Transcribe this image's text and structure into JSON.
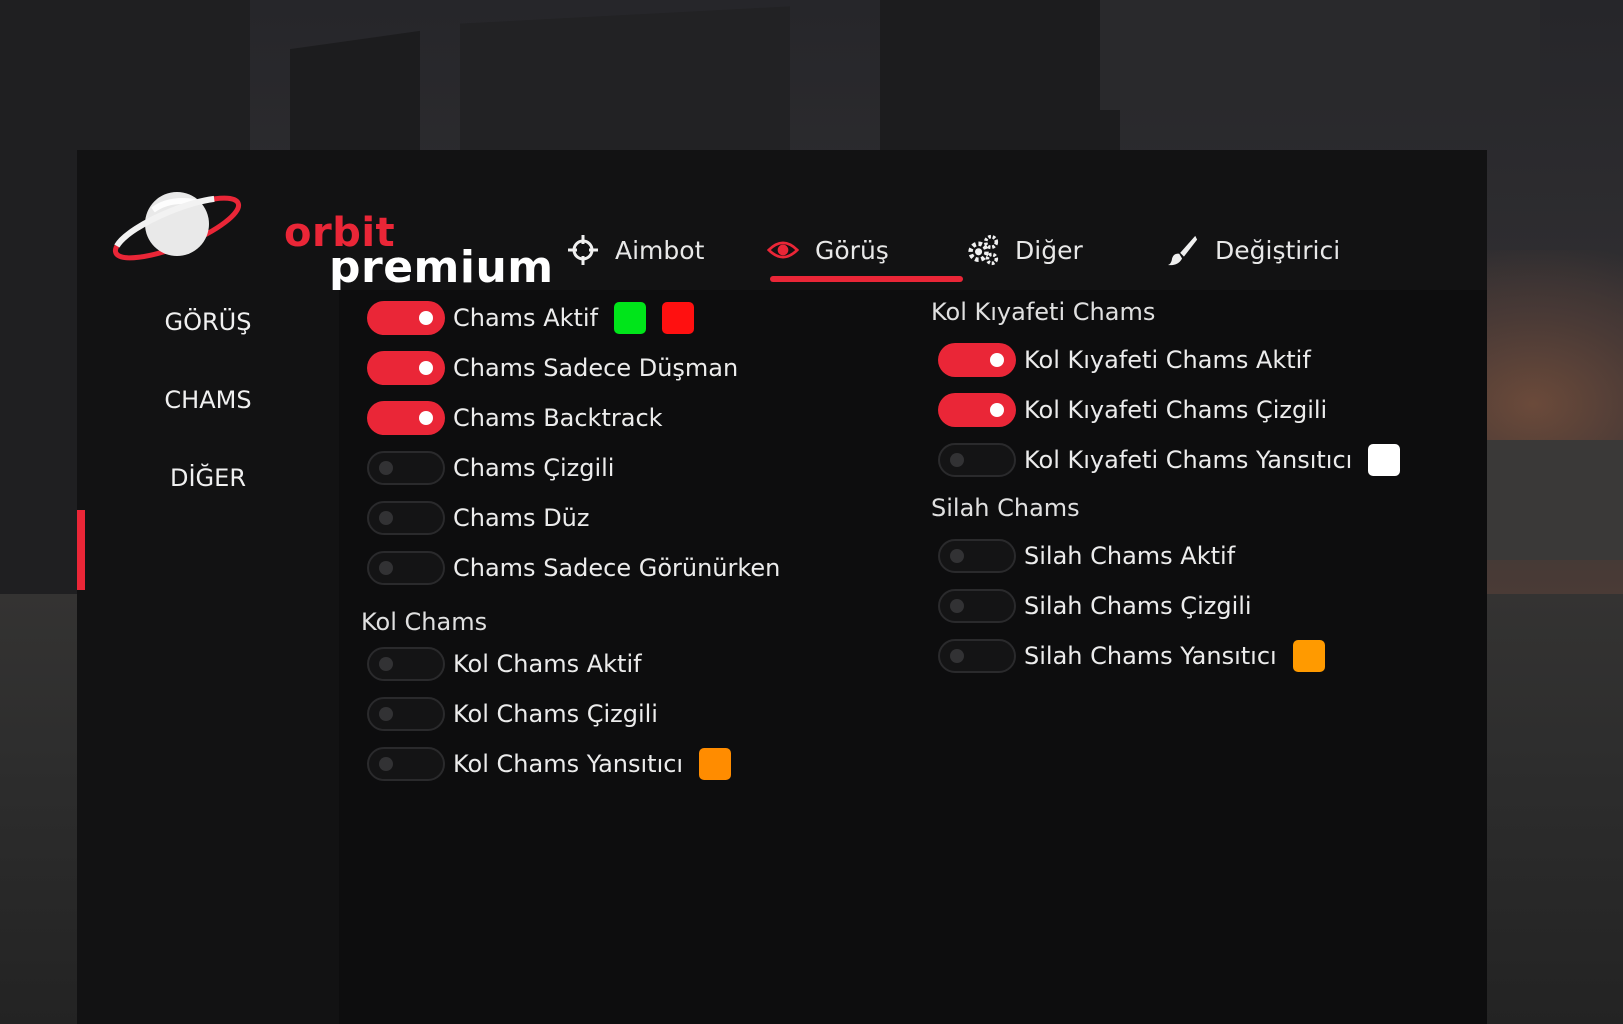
{
  "brand": {
    "line1": "orbit",
    "line2": "premium",
    "accent": "#ea2637"
  },
  "tabs": [
    {
      "label": "Aimbot",
      "icon": "crosshair-icon",
      "active": false
    },
    {
      "label": "Görüş",
      "icon": "eye-icon",
      "active": true
    },
    {
      "label": "Diğer",
      "icon": "gears-icon",
      "active": false
    },
    {
      "label": "Değiştirici",
      "icon": "brush-icon",
      "active": false
    }
  ],
  "sidebar": {
    "items": [
      {
        "label": "GÖRÜŞ",
        "active": false
      },
      {
        "label": "CHAMS",
        "active": true
      },
      {
        "label": "DİĞER",
        "active": false
      }
    ]
  },
  "left": {
    "chams_aktif": {
      "label": "Chams Aktif",
      "on": true,
      "colors": [
        "#00e51a",
        "#ff1010"
      ]
    },
    "chams_sadece_dusman": {
      "label": "Chams Sadece Düşman",
      "on": true
    },
    "chams_backtrack": {
      "label": "Chams Backtrack",
      "on": true
    },
    "chams_cizgili": {
      "label": "Chams Çizgili",
      "on": false
    },
    "chams_duz": {
      "label": "Chams Düz",
      "on": false
    },
    "chams_sadece_gorunurken": {
      "label": "Chams Sadece Görünürken",
      "on": false
    },
    "kol_section": "Kol Chams",
    "kol_aktif": {
      "label": "Kol Chams Aktif",
      "on": false
    },
    "kol_cizgili": {
      "label": "Kol Chams Çizgili",
      "on": false
    },
    "kol_yansitici": {
      "label": "Kol Chams Yansıtıcı",
      "on": false,
      "color": "#ff8c00"
    }
  },
  "right": {
    "kiyafet_section": "Kol Kıyafeti Chams",
    "kiyafet_aktif": {
      "label": "Kol Kıyafeti Chams Aktif",
      "on": true
    },
    "kiyafet_cizgili": {
      "label": "Kol Kıyafeti Chams Çizgili",
      "on": true
    },
    "kiyafet_yansitici": {
      "label": "Kol Kıyafeti Chams Yansıtıcı",
      "on": false,
      "color": "#ffffff"
    },
    "silah_section": "Silah Chams",
    "silah_aktif": {
      "label": "Silah Chams Aktif",
      "on": false
    },
    "silah_cizgili": {
      "label": "Silah Chams Çizgili",
      "on": false
    },
    "silah_yansitici": {
      "label": "Silah Chams Yansıtıcı",
      "on": false,
      "color": "#ff9a00"
    }
  }
}
